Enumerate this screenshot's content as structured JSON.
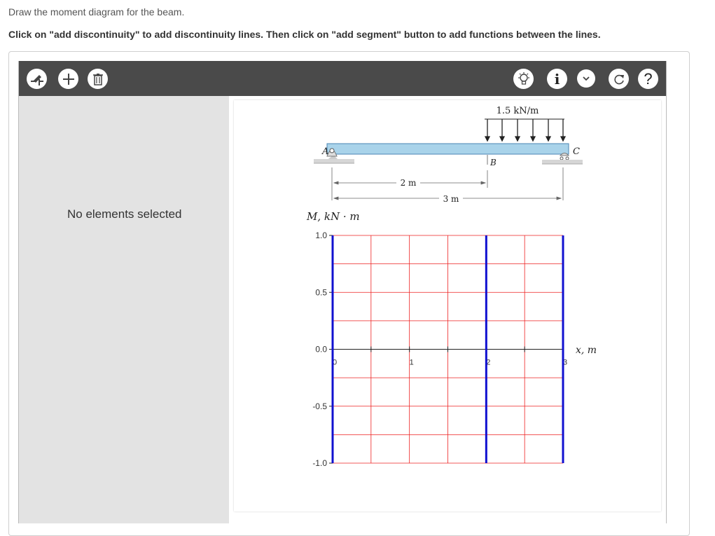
{
  "question": {
    "line1": "Draw the moment diagram for the beam.",
    "line2": "Click on \"add discontinuity\" to add discontinuity lines. Then click on \"add segment\" button to add functions between the lines."
  },
  "toolbar": {
    "left_tools": [
      "add-discontinuity-icon",
      "add-segment-icon",
      "delete-icon"
    ],
    "right_tools": [
      "hint-bulb-icon",
      "info-icon",
      "dropdown-chevron-icon",
      "redo-icon",
      "help-icon"
    ],
    "help_label": "?",
    "info_label": "i"
  },
  "side_panel": {
    "status": "No elements selected"
  },
  "beam": {
    "load_label": "1.5 kN/m",
    "support_a": "A",
    "point_b": "B",
    "support_c": "C",
    "dim_ab": "2 m",
    "dim_ac": "3 m"
  },
  "graph": {
    "ylabel": "M, kN · m",
    "xlabel": "x, m",
    "yticks": [
      "1.0",
      "0.5",
      "0.0",
      "-0.5",
      "-1.0"
    ],
    "xticks": [
      "0",
      "1",
      "2",
      "3"
    ],
    "discontinuity_x": [
      0,
      2,
      3
    ],
    "grid_color": "#ee2222",
    "discontinuity_color": "#1010d0"
  }
}
